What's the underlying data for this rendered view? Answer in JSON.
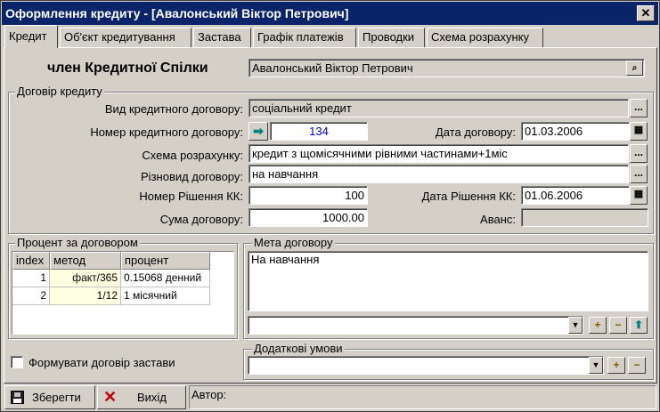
{
  "window": {
    "title": "Оформлення кредиту - [Авалонський Віктор Петрович]",
    "close": "✕"
  },
  "tabs": [
    {
      "label": "Кредит"
    },
    {
      "label": "Об'єкт кредитування"
    },
    {
      "label": "Застава"
    },
    {
      "label": "Графік платежів"
    },
    {
      "label": "Проводки"
    },
    {
      "label": "Схема розрахунку"
    }
  ],
  "member": {
    "label": "член Кредитної Спілки",
    "value": "Авалонський Віктор Петрович"
  },
  "contract": {
    "group_title": "Договір кредиту",
    "type_label": "Вид кредитного договору:",
    "type_value": "соціальний кредит",
    "number_label": "Номер кредитного договору:",
    "number_value": "134",
    "date_label": "Дата договору:",
    "date_value": "01.03.2006",
    "scheme_label": "Схема розрахунку:",
    "scheme_value": "кредит з щомісячними рівними частинами+1міс",
    "kind_label": "Різновид договору:",
    "kind_value": "на навчання",
    "decision_num_label": "Номер Рішення КК:",
    "decision_num_value": "100",
    "decision_date_label": "Дата Рішення КК:",
    "decision_date_value": "01.06.2006",
    "amount_label": "Сума договору:",
    "amount_value": "1000.00",
    "advance_label": "Аванс:",
    "advance_value": ""
  },
  "percent": {
    "group_title": "Процент за договором",
    "columns": [
      "index",
      "метод",
      "процент"
    ],
    "rows": [
      {
        "index": "1",
        "method": "факт/365",
        "percent": "0.15068 денний"
      },
      {
        "index": "2",
        "method": "1/12",
        "percent": "1 місячний"
      }
    ]
  },
  "purpose": {
    "group_title": "Мета договору",
    "text": "На навчання",
    "combo_value": ""
  },
  "extra": {
    "group_title": "Додаткові умови",
    "combo_value": ""
  },
  "pledge_checkbox": {
    "label": "Формувати договір застави",
    "checked": false
  },
  "footer": {
    "save_label": "Зберегти",
    "exit_label": "Вихід",
    "author_label": "Автор:"
  },
  "icons": {
    "ellipsis": "...",
    "plus": "+",
    "minus": "−",
    "dropdown": "▼",
    "up": "⬆",
    "arrow": "➡"
  }
}
